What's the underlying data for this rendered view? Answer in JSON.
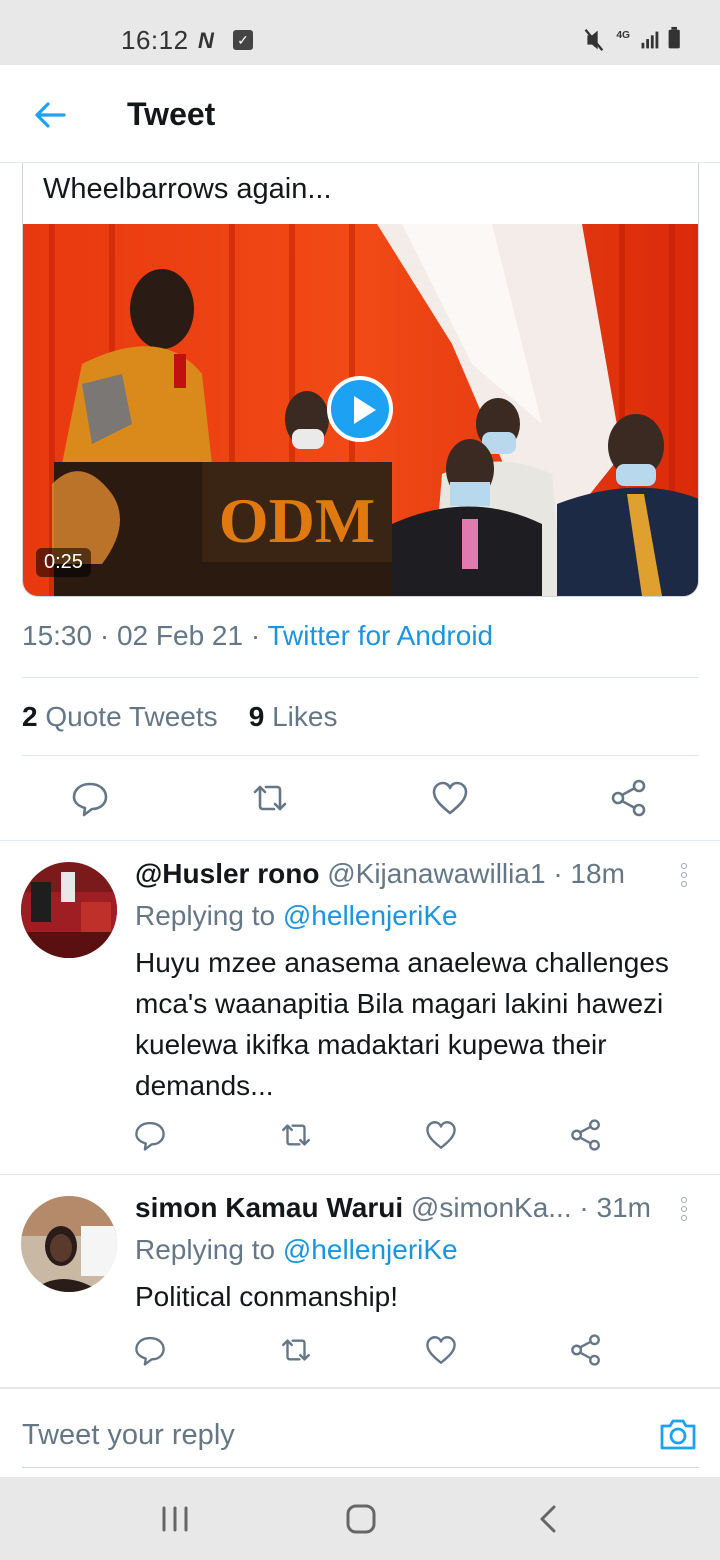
{
  "status_bar": {
    "time": "16:12",
    "network": "4G"
  },
  "header": {
    "title": "Tweet"
  },
  "quote": {
    "text": "Wheelbarrows again...",
    "video_duration": "0:25",
    "video_sign_text": "ODM"
  },
  "tweet_meta": {
    "time": "15:30",
    "date": "02 Feb 21",
    "source": "Twitter for Android"
  },
  "stats": {
    "quote_tweets_count": "2",
    "quote_tweets_label": "Quote Tweets",
    "likes_count": "9",
    "likes_label": "Likes"
  },
  "replies": [
    {
      "name": "@Husler rono",
      "handle": "@Kijanawawillia1",
      "time": "18m",
      "replying_label": "Replying to",
      "replying_to": "@hellenjeriKe",
      "text": "Huyu mzee anasema anaelewa challenges mca's waanapitia Bila magari lakini hawezi kuelewa ikifka madaktari kupewa their demands..."
    },
    {
      "name": "simon Kamau Warui",
      "handle": "@simonKa...",
      "time": "31m",
      "replying_label": "Replying to",
      "replying_to": "@hellenjeriKe",
      "text": "Political conmanship!"
    }
  ],
  "compose": {
    "placeholder": "Tweet your reply"
  },
  "icons": {
    "back": "arrow-left-icon",
    "reply": "comment-icon",
    "retweet": "retweet-icon",
    "like": "heart-icon",
    "share": "share-icon",
    "more": "more-vertical-icon",
    "camera": "camera-icon"
  },
  "colors": {
    "accent": "#1da1f2",
    "link": "#1b95e0",
    "secondary_text": "#657786",
    "primary_text": "#14171a"
  }
}
